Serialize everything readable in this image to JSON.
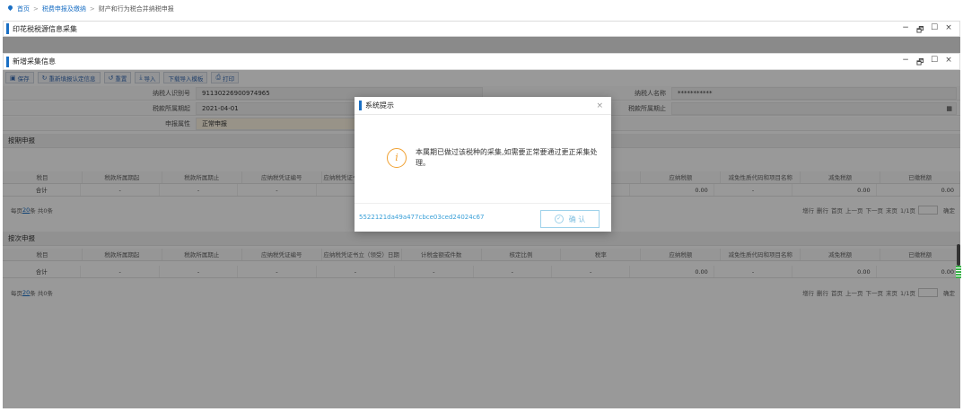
{
  "breadcrumb": {
    "home": "首页",
    "level2": "税费申报及缴纳",
    "current": "财产和行为税合并纳税申报",
    "sep": ">"
  },
  "panel1": {
    "title": "印花税税源信息采集"
  },
  "panel2": {
    "title": "新增采集信息"
  },
  "window_controls": {
    "minimize": "−",
    "restore": "🗗",
    "maximize": "☐",
    "close": "×"
  },
  "toolbar": {
    "save": "保存",
    "reacquire": "重新填报认定信息",
    "reset": "重置",
    "import": "导入",
    "download_template": "下载导入模板",
    "print": "打印"
  },
  "form": {
    "taxpayer_id_label": "纳税人识别号",
    "taxpayer_id_value": "91130226900974965",
    "taxpayer_name_label": "纳税人名称",
    "taxpayer_name_value": "***********",
    "period_start_label": "税款所属期起",
    "period_start_value": "2021-04-01",
    "period_end_label": "税款所属期止",
    "period_end_value": "",
    "declare_attr_label": "申报属性",
    "declare_attr_value": "正常申报"
  },
  "section_periodic": {
    "title": "按期申报"
  },
  "section_per_time": {
    "title": "按次申报"
  },
  "columns": [
    "税目",
    "税款所属期起",
    "税款所属期止",
    "应纳税凭证编号",
    "应纳税凭证书立（领受）日期",
    "计税金额或件数",
    "核定比例",
    "税率",
    "应纳税额",
    "减免性质代码和项目名称",
    "减免税额",
    "已缴税额"
  ],
  "totals_row": {
    "label": "合计",
    "dash": "-",
    "tax_payable": "0.00",
    "relief": "0.00",
    "paid": "0.00"
  },
  "pager": {
    "per_page_prefix": "每页",
    "per_page_count": "20",
    "per_page_suffix": "条 共0条",
    "add_row": "增行",
    "delete_row": "删行",
    "first": "首页",
    "prev": "上一页",
    "next": "下一页",
    "last": "末页",
    "page_info": "1/1页",
    "confirm": "确定"
  },
  "dialog": {
    "title": "系统提示",
    "message": "本属期已做过该税种的采集,如需要正常要通过更正采集处理。",
    "code": "5522121da49a477cbce03ced24024c67",
    "ok_label": "确 认"
  }
}
